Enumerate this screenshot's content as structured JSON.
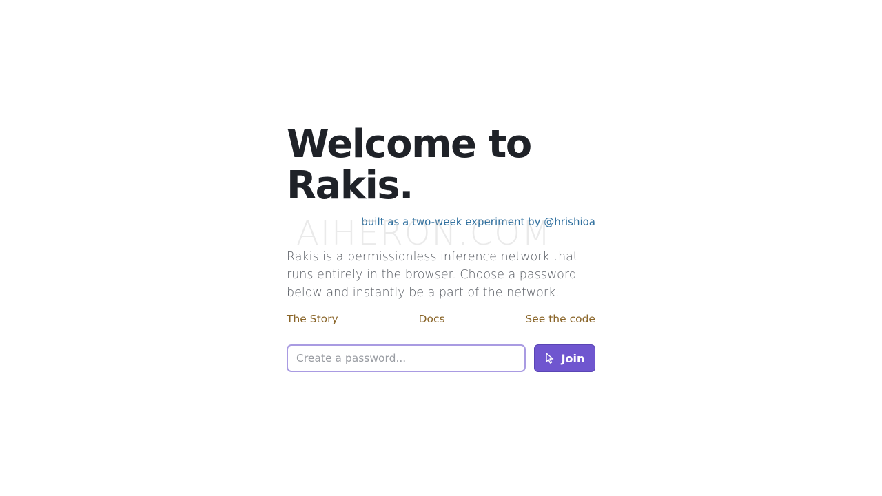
{
  "hero": {
    "title_line1": "Welcome to",
    "title_line2": "Rakis.",
    "byline": "built as a two-week experiment by @hrishioa"
  },
  "watermark": "AIHERON.COM",
  "description": "Rakis is a permissionless inference network that runs entirely in the browser. Choose a password below and instantly be a part of the network.",
  "links": {
    "story": "The Story",
    "docs": "Docs",
    "code": "See the code"
  },
  "join": {
    "password_placeholder": "Create a password...",
    "password_value": "",
    "button_label": "Join",
    "button_icon": "cursor-pointer-icon"
  },
  "colors": {
    "accent": "#6f56cf",
    "link": "#8a6529",
    "byline": "#2f6f9e",
    "title": "#1f2228"
  }
}
